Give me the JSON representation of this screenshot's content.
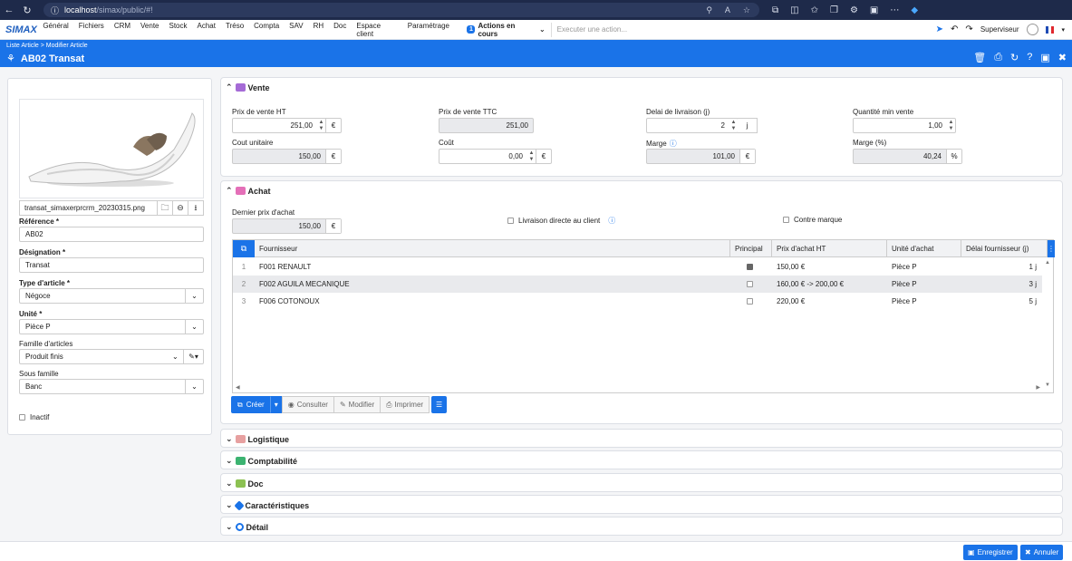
{
  "browser": {
    "url_host": "localhost",
    "url_path": "/simax/public/#!"
  },
  "app": {
    "logo": "SIMAX"
  },
  "menu": [
    "Général",
    "Fichiers",
    "CRM",
    "Vente",
    "Stock",
    "Achat",
    "Tréso",
    "Compta",
    "SAV",
    "RH",
    "Doc",
    "Espace client",
    "Paramétrage"
  ],
  "actions": {
    "count": "1",
    "label": "Actions en cours"
  },
  "exec_placeholder": "Executer une action...",
  "user": {
    "name": "Superviseur"
  },
  "breadcrumb": {
    "parent": "Liste Article",
    "sep": ">",
    "current": "Modifier Article"
  },
  "page_title": "AB02 Transat",
  "left": {
    "file_name": "transat_simaxerprcrm_20230315.png",
    "reference_label": "Référence *",
    "reference_value": "AB02",
    "designation_label": "Désignation *",
    "designation_value": "Transat",
    "type_label": "Type d'article *",
    "type_value": "Négoce",
    "unite_label": "Unité *",
    "unite_value": "Pièce P",
    "famille_label": "Famille d'articles",
    "famille_value": "Produit finis",
    "sousfamille_label": "Sous famille",
    "sousfamille_value": "Banc",
    "inactif_label": "Inactif"
  },
  "vente": {
    "title": "Vente",
    "pvht_label": "Prix de vente HT",
    "pvht_value": "251,00",
    "pvht_unit": "€",
    "pvttc_label": "Prix de vente TTC",
    "pvttc_value": "251,00",
    "delai_label": "Delai de livraison (j)",
    "delai_value": "2",
    "delai_unit": "j",
    "qmin_label": "Quantité min vente",
    "qmin_value": "1,00",
    "cout_unit_label": "Cout unitaire",
    "cout_unit_value": "150,00",
    "cout_unit_unit": "€",
    "cout_label": "Coût",
    "cout_value": "0,00",
    "cout_unit": "€",
    "marge_label": "Marge",
    "marge_value": "101,00",
    "marge_unit": "€",
    "margep_label": "Marge (%)",
    "margep_value": "40,24",
    "margep_unit": "%"
  },
  "achat": {
    "title": "Achat",
    "dernier_label": "Dernier prix d'achat",
    "dernier_value": "150,00",
    "dernier_unit": "€",
    "livraison_label": "Livraison directe au client",
    "contre_label": "Contre marque",
    "columns": {
      "fournisseur": "Fournisseur",
      "principal": "Principal",
      "prix": "Prix d'achat HT",
      "unite": "Unité d'achat",
      "delai": "Délai fournisseur (j)"
    },
    "rows": [
      {
        "n": "1",
        "fournisseur": "F001 RENAULT",
        "principal": true,
        "prix": "150,00 €",
        "unite": "Pièce P",
        "delai": "1 j"
      },
      {
        "n": "2",
        "fournisseur": "F002 AGUILA MECANIQUE",
        "principal": false,
        "prix": "160,00 € -> 200,00 €",
        "unite": "Pièce P",
        "delai": "3 j"
      },
      {
        "n": "3",
        "fournisseur": "F006 COTONOUX",
        "principal": false,
        "prix": "220,00 €",
        "unite": "Pièce P",
        "delai": "5 j"
      }
    ],
    "buttons": {
      "creer": "Créer",
      "consulter": "Consulter",
      "modifier": "Modifier",
      "imprimer": "Imprimer"
    }
  },
  "sections": [
    "Logistique",
    "Comptabilité",
    "Doc",
    "Caractéristiques",
    "Détail"
  ],
  "footer": {
    "save": "Enregistrer",
    "cancel": "Annuler"
  }
}
